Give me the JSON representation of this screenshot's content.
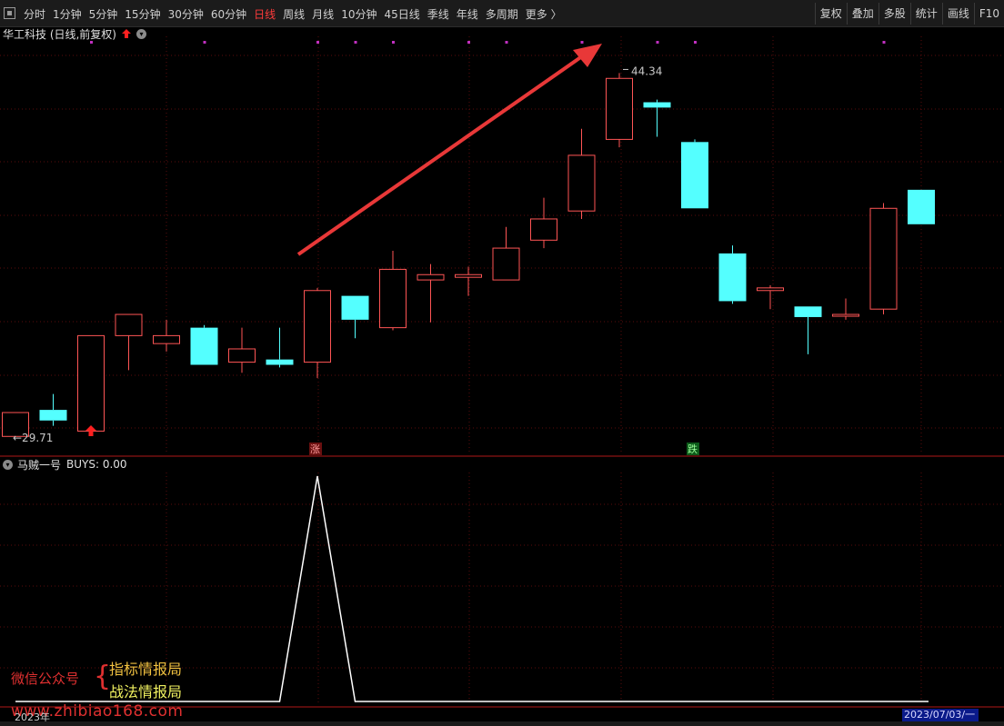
{
  "toolbar": {
    "period_tabs": [
      "分时",
      "1分钟",
      "5分钟",
      "15分钟",
      "30分钟",
      "60分钟",
      "日线",
      "周线",
      "月线",
      "10分钟",
      "45日线",
      "季线",
      "年线",
      "多周期",
      "更多 〉"
    ],
    "active_tab": "日线",
    "right_tools": [
      "复权",
      "叠加",
      "多股",
      "统计",
      "画线",
      "F10"
    ]
  },
  "main_pane": {
    "title": "华工科技 (日线,前复权)",
    "high_label": "44.34",
    "low_label": "29.71",
    "rise_marker": "涨",
    "fall_marker": "跌"
  },
  "indicator_pane": {
    "title": "马贼一号",
    "value_label": "BUYS: 0.00"
  },
  "watermark": {
    "wechat_label": "微信公众号",
    "brace": "{",
    "name1": "指标情报局",
    "name2": "战法情报局",
    "url": "www.zhibiao168.com"
  },
  "axis": {
    "start_date": "2023年",
    "end_date": "2023/07/03/一"
  },
  "colors": {
    "up": "#ff5555",
    "down": "#54ffff",
    "arrow": "#e83838",
    "marker_dot": "#c030c0",
    "line": "#ffffff"
  },
  "chart_data": [
    {
      "type": "candlestick",
      "title": "华工科技 (日线,前复权)",
      "y_range": [
        29.71,
        44.34
      ],
      "candles": [
        {
          "o": 29.7,
          "h": 30.2,
          "l": 29.7,
          "c": 30.6,
          "dir": "up"
        },
        {
          "o": 30.7,
          "h": 31.3,
          "l": 30.1,
          "c": 30.3,
          "dir": "down"
        },
        {
          "o": 29.9,
          "h": 33.5,
          "l": 29.9,
          "c": 33.5,
          "dir": "up"
        },
        {
          "o": 33.5,
          "h": 34.3,
          "l": 32.2,
          "c": 34.3,
          "dir": "up"
        },
        {
          "o": 33.5,
          "h": 34.1,
          "l": 32.9,
          "c": 33.2,
          "dir": "up"
        },
        {
          "o": 33.8,
          "h": 33.9,
          "l": 32.4,
          "c": 32.4,
          "dir": "down"
        },
        {
          "o": 32.5,
          "h": 33.8,
          "l": 32.1,
          "c": 33.0,
          "dir": "up"
        },
        {
          "o": 32.6,
          "h": 33.8,
          "l": 32.3,
          "c": 32.4,
          "dir": "down"
        },
        {
          "o": 32.5,
          "h": 35.3,
          "l": 31.9,
          "c": 35.2,
          "dir": "up"
        },
        {
          "o": 35.0,
          "h": 35.0,
          "l": 33.4,
          "c": 34.1,
          "dir": "down"
        },
        {
          "o": 33.8,
          "h": 36.7,
          "l": 33.7,
          "c": 36.0,
          "dir": "up"
        },
        {
          "o": 35.6,
          "h": 36.2,
          "l": 34.0,
          "c": 35.8,
          "dir": "up"
        },
        {
          "o": 35.7,
          "h": 36.1,
          "l": 35.0,
          "c": 35.8,
          "dir": "up"
        },
        {
          "o": 35.6,
          "h": 37.6,
          "l": 35.6,
          "c": 36.8,
          "dir": "up"
        },
        {
          "o": 37.1,
          "h": 38.7,
          "l": 36.8,
          "c": 37.9,
          "dir": "up"
        },
        {
          "o": 38.2,
          "h": 41.3,
          "l": 37.9,
          "c": 40.3,
          "dir": "up"
        },
        {
          "o": 40.9,
          "h": 43.4,
          "l": 40.6,
          "c": 43.2,
          "dir": "up"
        },
        {
          "o": 42.3,
          "h": 42.4,
          "l": 41.0,
          "c": 42.1,
          "dir": "down"
        },
        {
          "o": 40.8,
          "h": 40.9,
          "l": 38.3,
          "c": 38.3,
          "dir": "down"
        },
        {
          "o": 36.6,
          "h": 36.9,
          "l": 34.7,
          "c": 34.8,
          "dir": "down"
        },
        {
          "o": 35.3,
          "h": 35.4,
          "l": 34.5,
          "c": 35.2,
          "dir": "up"
        },
        {
          "o": 34.6,
          "h": 34.6,
          "l": 32.8,
          "c": 34.2,
          "dir": "down"
        },
        {
          "o": 34.3,
          "h": 34.9,
          "l": 34.1,
          "c": 34.3,
          "dir": "up"
        },
        {
          "o": 34.5,
          "h": 38.5,
          "l": 34.3,
          "c": 38.3,
          "dir": "up"
        },
        {
          "o": 39.0,
          "h": 39.0,
          "l": 37.7,
          "c": 37.7,
          "dir": "down"
        }
      ]
    },
    {
      "type": "line",
      "title": "马贼一号",
      "series": [
        {
          "name": "BUYS",
          "values": [
            0,
            0,
            0,
            0,
            0,
            0,
            0,
            0,
            1,
            0,
            0,
            0,
            0,
            0,
            0,
            0,
            0,
            0,
            0,
            0,
            0,
            0,
            0,
            0,
            0
          ]
        }
      ]
    }
  ]
}
